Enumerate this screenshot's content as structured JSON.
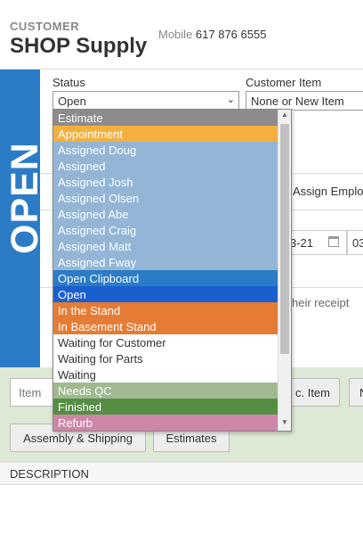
{
  "header": {
    "customer_label": "CUSTOMER",
    "customer_name": "SHOP Supply",
    "mobile_label": "Mobile",
    "mobile_number": "617 876 6555"
  },
  "status_band": {
    "text": "OPEN",
    "color": "#2b7bc6"
  },
  "status": {
    "label": "Status",
    "selected": "Open",
    "options": [
      {
        "label": "Estimate",
        "bg": "#8c8c8c",
        "fg": "#ffffff"
      },
      {
        "label": "Appointment",
        "bg": "#f4b03e",
        "fg": "#ffffff"
      },
      {
        "label": "Assigned Doug",
        "bg": "#93b6d7",
        "fg": "#ffffff"
      },
      {
        "label": "Assigned",
        "bg": "#93b6d7",
        "fg": "#ffffff"
      },
      {
        "label": "Assigned Josh",
        "bg": "#93b6d7",
        "fg": "#ffffff"
      },
      {
        "label": "Assigned Olsen",
        "bg": "#93b6d7",
        "fg": "#ffffff"
      },
      {
        "label": "Assigned Abe",
        "bg": "#93b6d7",
        "fg": "#ffffff"
      },
      {
        "label": "Assigned Craig",
        "bg": "#93b6d7",
        "fg": "#ffffff"
      },
      {
        "label": "Assigned Matt",
        "bg": "#93b6d7",
        "fg": "#ffffff"
      },
      {
        "label": "Assigned Fway",
        "bg": "#93b6d7",
        "fg": "#ffffff"
      },
      {
        "label": "Open Clipboard",
        "bg": "#2b7bc6",
        "fg": "#ffffff"
      },
      {
        "label": "Open",
        "bg": "#1a5fcf",
        "fg": "#ffffff"
      },
      {
        "label": "In the Stand",
        "bg": "#e57c36",
        "fg": "#ffffff"
      },
      {
        "label": "In Basement Stand",
        "bg": "#e57c36",
        "fg": "#ffffff"
      },
      {
        "label": "Waiting for Customer",
        "bg": "#ffffff",
        "fg": "#333333"
      },
      {
        "label": "Waiting for Parts",
        "bg": "#ffffff",
        "fg": "#333333"
      },
      {
        "label": "Waiting",
        "bg": "#ffffff",
        "fg": "#333333"
      },
      {
        "label": "Needs QC",
        "bg": "#9fba90",
        "fg": "#ffffff"
      },
      {
        "label": "Finished",
        "bg": "#548e43",
        "fg": "#ffffff"
      },
      {
        "label": "Refurb",
        "bg": "#ce86a8",
        "fg": "#ffffff"
      }
    ]
  },
  "customer_item": {
    "label": "Customer Item",
    "value": "None or New Item"
  },
  "assign_employee": "Assign Employ",
  "date_value": "3-21",
  "time_value": "03",
  "receipt_text": "heir receipt",
  "bottom": {
    "item_placeholder": "Item",
    "misc_item": "c. Item",
    "n_button": "N",
    "assembly_shipping": "Assembly & Shipping",
    "estimates": "Estimates"
  },
  "description_header": "DESCRIPTION"
}
